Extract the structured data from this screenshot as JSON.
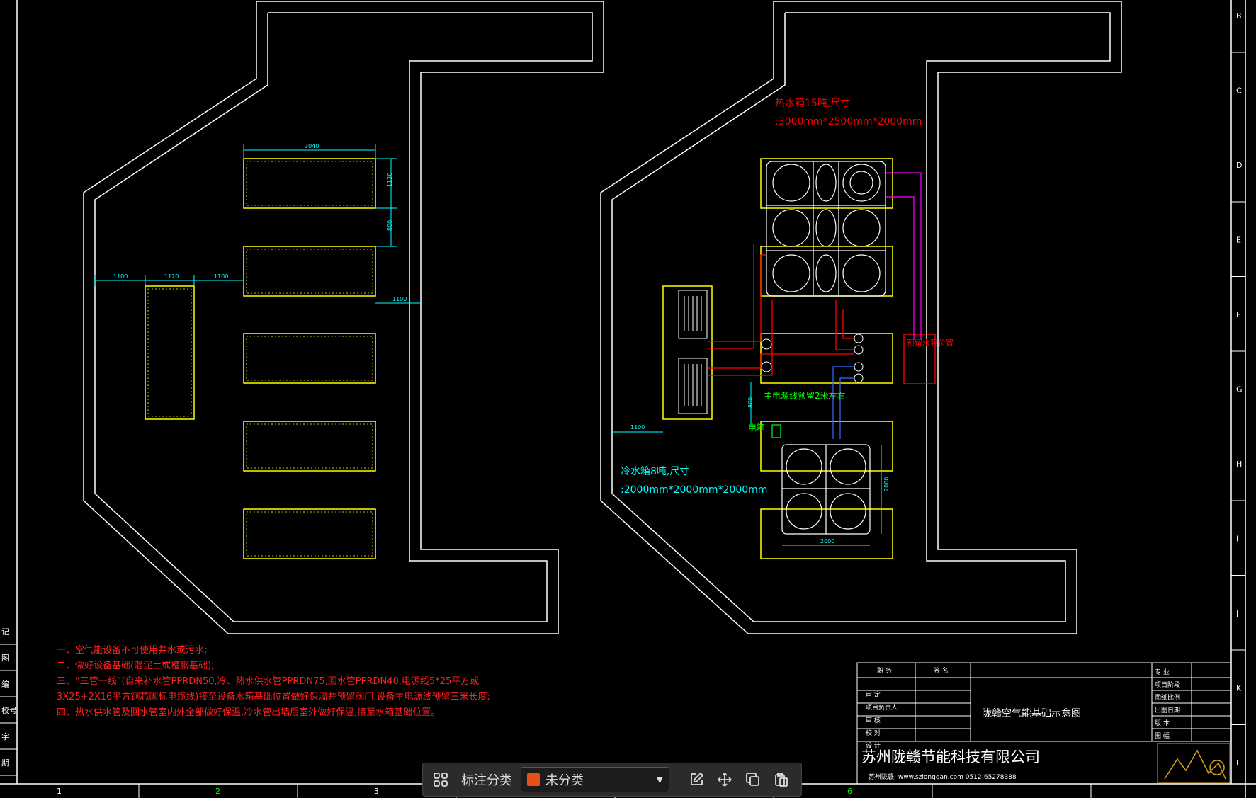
{
  "colors": {
    "frame": "#ffffff",
    "yellow": "#ffff00",
    "cyan": "#00ffff",
    "red": "#ff0000",
    "green": "#00ff00",
    "magenta": "#ff00ff",
    "blue": "#3a6bff",
    "note": "#ff2020",
    "accent": "#e8501a"
  },
  "border": {
    "right_letters": [
      "B",
      "C",
      "D",
      "E",
      "F",
      "G",
      "H",
      "I",
      "J",
      "K",
      "L"
    ],
    "bottom_numbers": [
      "1",
      "2",
      "3",
      "6"
    ],
    "left_labels": [
      "记",
      "图",
      "编",
      "校号",
      "字",
      "期"
    ]
  },
  "dimensions_left": {
    "top_width": "3040",
    "side_gap": "1100",
    "mid": "1120",
    "right_gap": "1100",
    "right_dim": "1100",
    "h1": "1120",
    "h2": "800"
  },
  "hot_tank": {
    "title_line1": "热水箱15吨,尺寸",
    "title_line2": ":3000mm*2500mm*2000mm"
  },
  "cold_tank": {
    "title_line1": "冷水箱8吨,尺寸",
    "title_line2": ":2000mm*2000mm*2000mm",
    "dim_w": "2000",
    "dim_h": "2000"
  },
  "labels": {
    "power_reserve": "主电源线预留2米左右",
    "electric_box": "电箱",
    "pre_reserve": "预留水泵位置",
    "offset_dim": "1100",
    "vert_dim": "800"
  },
  "notes": [
    "一、空气能设备不可使用井水或污水;",
    "二、做好设备基础(混泥土或槽钢基础);",
    "三、“三管一线”(自来补水管PPRDN50,冷、热水供水管PPRDN75,回水管PPRDN40,电源线5*25平方或",
    "3X25+2X16平方铜芯国标电缆线)接至设备水箱基础位置做好保温并预留阀门,设备主电源线预留三米长度;",
    "四、热水供水管及回水管室内外全部做好保温,冷水管出墙后室外做好保温,接至水箱基础位置。"
  ],
  "title_block": {
    "left_rows": [
      "审 定",
      "项目负责人",
      "审 核",
      "校 对",
      "设 计"
    ],
    "top_left_a": "职 务",
    "top_left_b": "签 名",
    "drawing_title": "陇赣空气能基础示意图",
    "right_rows": [
      "专 业",
      "项目阶段",
      "图纸比例",
      "出图日期",
      "版 本",
      "图 幅"
    ],
    "company": "苏州陇赣节能科技有限公司",
    "contact": "苏州陇赣: www.szlonggan.com 0512-65278388"
  },
  "toolbar": {
    "classify_label": "标注分类",
    "category_value": "未分类",
    "swatch_color": "#e8501a"
  }
}
